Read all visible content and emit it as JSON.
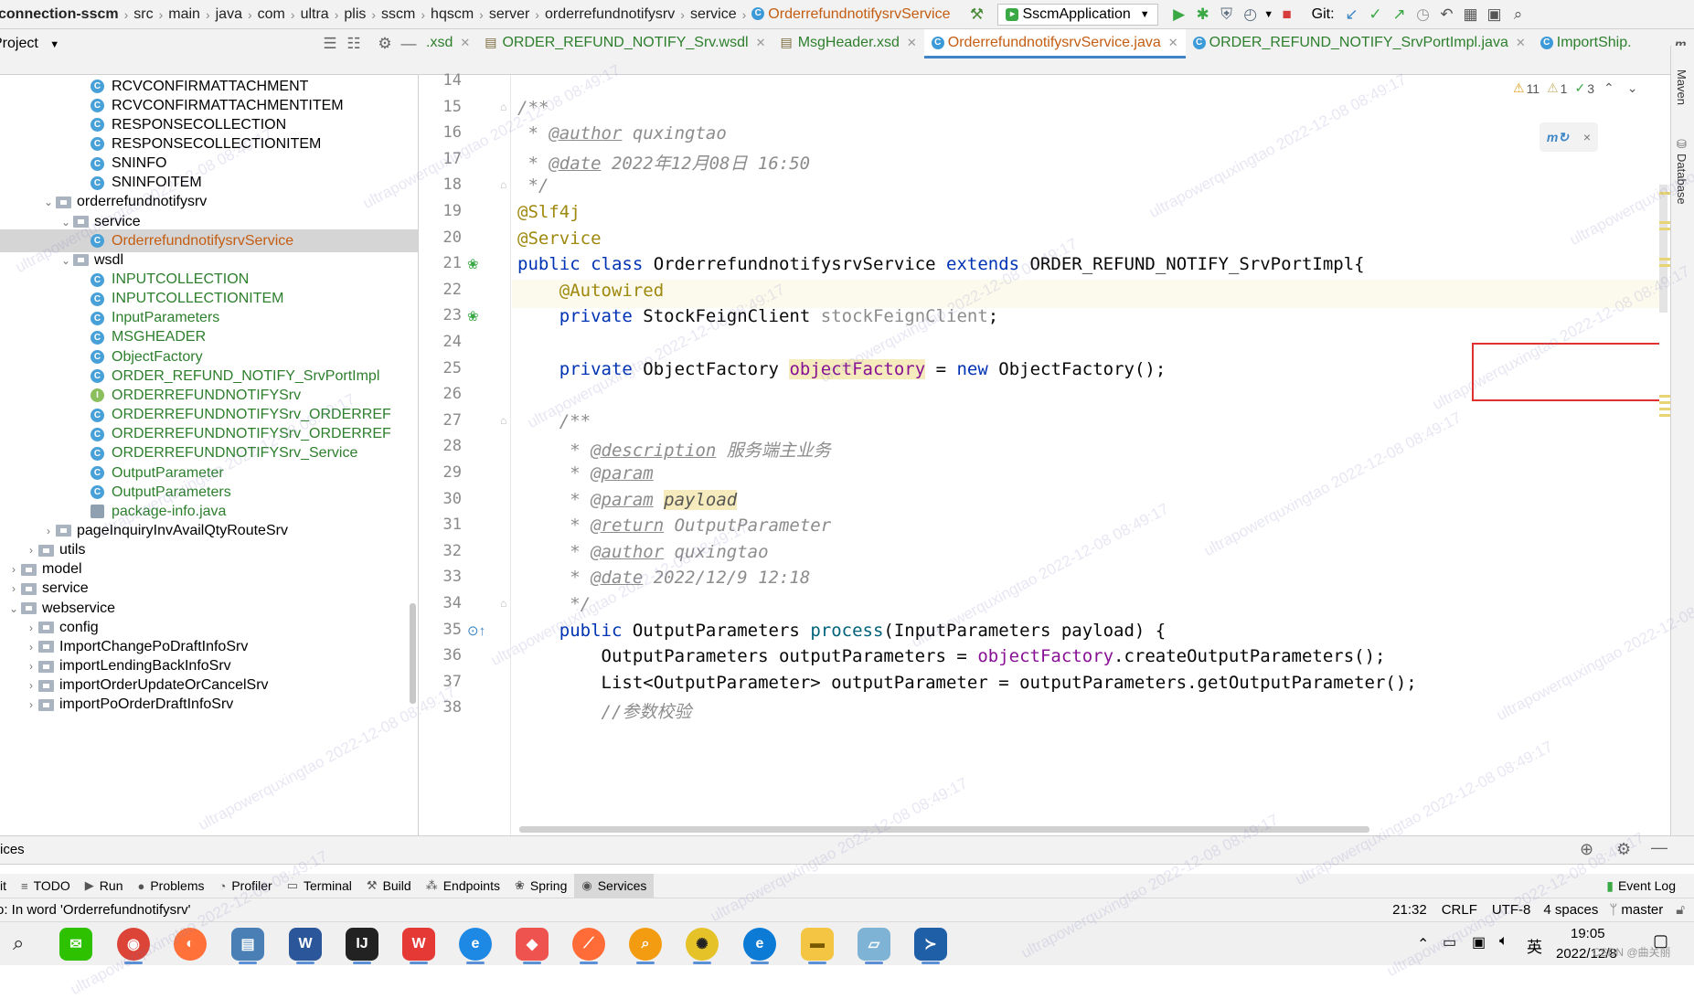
{
  "breadcrumb": {
    "items": [
      "connection-sscm",
      "src",
      "main",
      "java",
      "com",
      "ultra",
      "plis",
      "sscm",
      "hqscm",
      "server",
      "orderrefundnotifysrv",
      "service"
    ],
    "current": "OrderrefundnotifysrvService"
  },
  "toolbar": {
    "run_config": "SscmApplication",
    "git_label": "Git:"
  },
  "project_panel": {
    "title": "Project"
  },
  "editor_tabs": [
    {
      "label": ".xsd",
      "active": false
    },
    {
      "label": "ORDER_REFUND_NOTIFY_Srv.wsdl",
      "active": false
    },
    {
      "label": "MsgHeader.xsd",
      "active": false
    },
    {
      "label": "OrderrefundnotifysrvService.java",
      "active": true
    },
    {
      "label": "ORDER_REFUND_NOTIFY_SrvPortImpl.java",
      "active": false
    },
    {
      "label": "ImportShip.",
      "active": false
    }
  ],
  "tree": [
    {
      "label": "RCVCONFIRMATTACHMENT",
      "depth": 7,
      "icon": "class"
    },
    {
      "label": "RCVCONFIRMATTACHMENTITEM",
      "depth": 7,
      "icon": "class"
    },
    {
      "label": "RESPONSECOLLECTION",
      "depth": 7,
      "icon": "class"
    },
    {
      "label": "RESPONSECOLLECTIONITEM",
      "depth": 7,
      "icon": "class"
    },
    {
      "label": "SNINFO",
      "depth": 7,
      "icon": "class"
    },
    {
      "label": "SNINFOITEM",
      "depth": 7,
      "icon": "class"
    },
    {
      "label": "orderrefundnotifysrv",
      "depth": 5,
      "icon": "package",
      "expanded": true
    },
    {
      "label": "service",
      "depth": 6,
      "icon": "package",
      "expanded": true
    },
    {
      "label": "OrderrefundnotifysrvService",
      "depth": 7,
      "icon": "class",
      "color": "orange",
      "selected": true
    },
    {
      "label": "wsdl",
      "depth": 6,
      "icon": "package",
      "expanded": true
    },
    {
      "label": "INPUTCOLLECTION",
      "depth": 7,
      "icon": "class",
      "color": "green"
    },
    {
      "label": "INPUTCOLLECTIONITEM",
      "depth": 7,
      "icon": "class",
      "color": "green"
    },
    {
      "label": "InputParameters",
      "depth": 7,
      "icon": "class",
      "color": "green"
    },
    {
      "label": "MSGHEADER",
      "depth": 7,
      "icon": "class",
      "color": "green"
    },
    {
      "label": "ObjectFactory",
      "depth": 7,
      "icon": "class",
      "color": "green"
    },
    {
      "label": "ORDER_REFUND_NOTIFY_SrvPortImpl",
      "depth": 7,
      "icon": "class",
      "color": "green"
    },
    {
      "label": "ORDERREFUNDNOTIFYSrv",
      "depth": 7,
      "icon": "interface",
      "color": "green"
    },
    {
      "label": "ORDERREFUNDNOTIFYSrv_ORDERREF",
      "depth": 7,
      "icon": "class",
      "color": "green"
    },
    {
      "label": "ORDERREFUNDNOTIFYSrv_ORDERREF",
      "depth": 7,
      "icon": "class",
      "color": "green"
    },
    {
      "label": "ORDERREFUNDNOTIFYSrv_Service",
      "depth": 7,
      "icon": "class",
      "color": "green"
    },
    {
      "label": "OutputParameter",
      "depth": 7,
      "icon": "class",
      "color": "green"
    },
    {
      "label": "OutputParameters",
      "depth": 7,
      "icon": "class",
      "color": "green"
    },
    {
      "label": "package-info.java",
      "depth": 7,
      "icon": "file",
      "color": "green"
    },
    {
      "label": "pageInquiryInvAvailQtyRouteSrv",
      "depth": 5,
      "icon": "package",
      "expanded": false
    },
    {
      "label": "utils",
      "depth": 4,
      "icon": "package",
      "expanded": false
    },
    {
      "label": "model",
      "depth": 3,
      "icon": "package",
      "expanded": false
    },
    {
      "label": "service",
      "depth": 3,
      "icon": "package",
      "expanded": false
    },
    {
      "label": "webservice",
      "depth": 3,
      "icon": "package",
      "expanded": true
    },
    {
      "label": "config",
      "depth": 4,
      "icon": "package",
      "expanded": false
    },
    {
      "label": "ImportChangePoDraftInfoSrv",
      "depth": 4,
      "icon": "package",
      "expanded": false
    },
    {
      "label": "importLendingBackInfoSrv",
      "depth": 4,
      "icon": "package",
      "expanded": false
    },
    {
      "label": "importOrderUpdateOrCancelSrv",
      "depth": 4,
      "icon": "package",
      "expanded": false
    },
    {
      "label": "importPoOrderDraftInfoSrv",
      "depth": 4,
      "icon": "package",
      "expanded": false
    }
  ],
  "code": {
    "line_numbers": [
      "14",
      "15",
      "16",
      "17",
      "18",
      "19",
      "20",
      "21",
      "22",
      "23",
      "24",
      "25",
      "26",
      "27",
      "28",
      "29",
      "30",
      "31",
      "32",
      "33",
      "34",
      "35",
      "36",
      "37",
      "38"
    ],
    "lines": [
      "",
      "/**",
      " * @author quxingtao",
      " * @date 2022年12月08日 16:50",
      " */",
      "@Slf4j",
      "@Service",
      "public class OrderrefundnotifysrvService extends ORDER_REFUND_NOTIFY_SrvPortImpl{",
      "    @Autowired",
      "    private StockFeignClient stockFeignClient;",
      "",
      "    private ObjectFactory objectFactory = new ObjectFactory();",
      "",
      "    /**",
      "     * @description 服务端主业务",
      "     * @param",
      "     * @param payload",
      "     * @return OutputParameter",
      "     * @author quxingtao",
      "     * @date 2022/12/9 12:18",
      "     */",
      "    public OutputParameters process(InputParameters payload) {",
      "        OutputParameters outputParameters = objectFactory.createOutputParameters();",
      "        List<OutputParameter> outputParameter = outputParameters.getOutputParameter();",
      "        //参数校验"
    ]
  },
  "inspections": {
    "warnings": "11",
    "weak_warnings": "1",
    "ok": "3"
  },
  "right_tools": [
    "Maven",
    "Database"
  ],
  "services_bar": {
    "label": "ices"
  },
  "tool_tabs": [
    {
      "label": "it",
      "icon": ""
    },
    {
      "label": "TODO",
      "icon": "≡"
    },
    {
      "label": "Run",
      "icon": "▶"
    },
    {
      "label": "Problems",
      "icon": "●"
    },
    {
      "label": "Profiler",
      "icon": "◔"
    },
    {
      "label": "Terminal",
      "icon": "▭"
    },
    {
      "label": "Build",
      "icon": "⚒"
    },
    {
      "label": "Endpoints",
      "icon": "⁂"
    },
    {
      "label": "Spring",
      "icon": "❀"
    },
    {
      "label": "Services",
      "icon": "◉",
      "active": true
    }
  ],
  "event_log": "Event Log",
  "status": {
    "message": "o: In word 'Orderrefundnotifysrv'",
    "position": "21:32",
    "line_sep": "CRLF",
    "encoding": "UTF-8",
    "indent": "4 spaces",
    "branch": "master"
  },
  "taskbar": {
    "time": "19:05",
    "date": "2022/12/8",
    "ime": "英",
    "watermark_user": "CSDN @曲关丽"
  },
  "watermark_text": "ultrapowerquxingtao 2022-12-08 08:49:17"
}
